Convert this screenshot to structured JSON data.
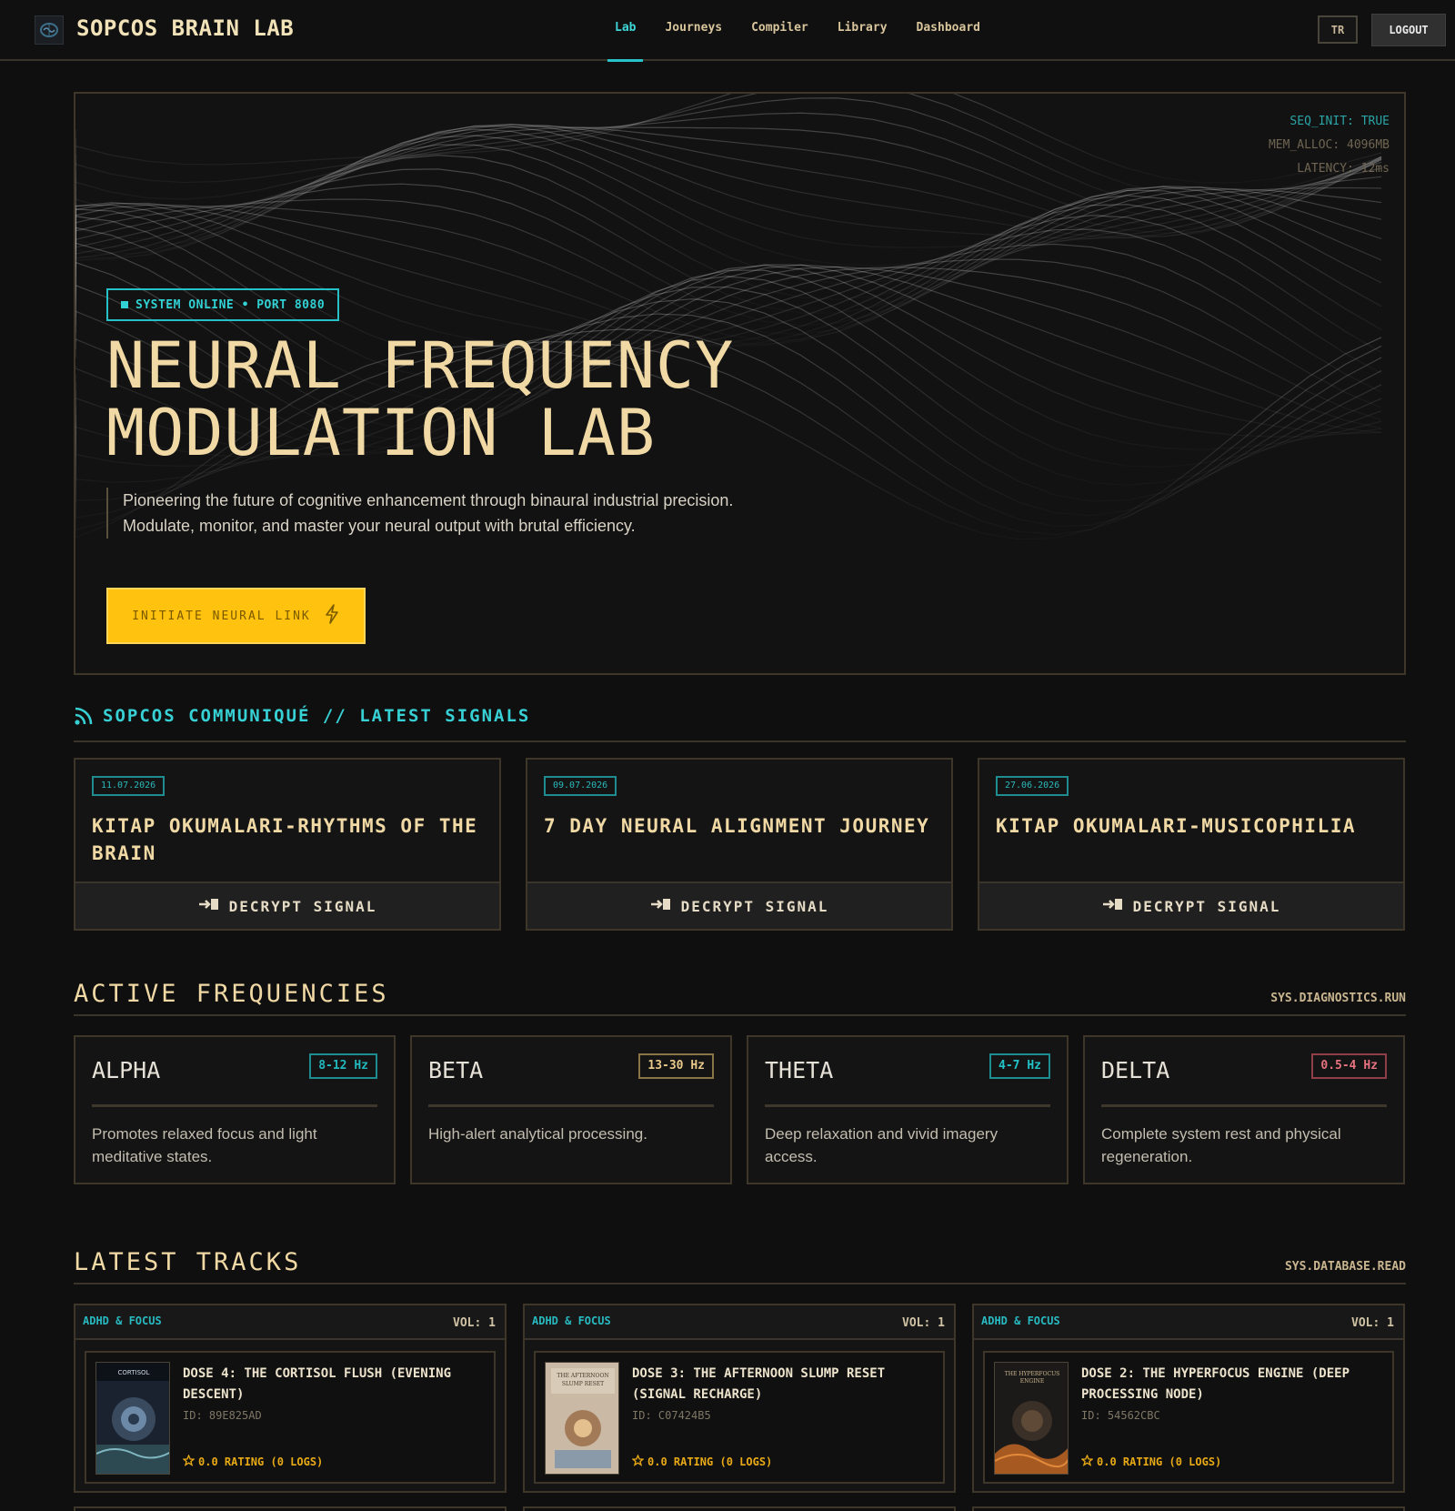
{
  "nav": {
    "brand": "SOPCOS BRAIN LAB",
    "links": [
      "Lab",
      "Journeys",
      "Compiler",
      "Library",
      "Dashboard"
    ],
    "active": "Lab",
    "lang_button": "TR",
    "logout_button": "LOGOUT"
  },
  "hero": {
    "stats": [
      "SEQ_INIT: TRUE",
      "MEM_ALLOC: 4096MB",
      "LATENCY: 12ms"
    ],
    "badge": "SYSTEM ONLINE • PORT 8080",
    "title_line1": "NEURAL FREQUENCY",
    "title_line2": "MODULATION LAB",
    "description": "Pioneering the future of cognitive enhancement through binaural industrial precision. Modulate, monitor, and master your neural output with brutal efficiency.",
    "cta": "INITIATE NEURAL LINK"
  },
  "communique": {
    "title": "SOPCOS COMMUNIQUÉ // LATEST SIGNALS",
    "icon": "rss-icon",
    "signals": [
      {
        "date": "11.07.2026",
        "title": "KITAP OKUMALARI-RHYTHMS OF THE BRAIN",
        "action": "DECRYPT SIGNAL"
      },
      {
        "date": "09.07.2026",
        "title": "7 DAY NEURAL ALIGNMENT JOURNEY",
        "action": "DECRYPT SIGNAL"
      },
      {
        "date": "27.06.2026",
        "title": "KITAP OKUMALARI-MUSICOPHILIA",
        "action": "DECRYPT SIGNAL"
      }
    ]
  },
  "frequencies": {
    "title": "ACTIVE FREQUENCIES",
    "meta": "SYS.DIAGNOSTICS.RUN",
    "items": [
      {
        "name": "ALPHA",
        "range": "8-12 Hz",
        "color": "#22b8bd",
        "description": "Promotes relaxed focus and light meditative states."
      },
      {
        "name": "BETA",
        "range": "13-30 Hz",
        "color": "#e9c98a",
        "description": "High-alert analytical processing."
      },
      {
        "name": "THETA",
        "range": "4-7 Hz",
        "color": "#22c3c8",
        "description": "Deep relaxation and vivid imagery access."
      },
      {
        "name": "DELTA",
        "range": "0.5-4 Hz",
        "color": "#e6737f",
        "description": "Complete system rest and physical regeneration."
      }
    ]
  },
  "tracks": {
    "title": "LATEST TRACKS",
    "meta": "SYS.DATABASE.READ",
    "items": [
      {
        "category": "ADHD & FOCUS",
        "vol": "VOL: 1",
        "title": "DOSE 4: THE CORTISOL FLUSH (EVENING DESCENT)",
        "id": "ID: 89E825AD",
        "rating": "0.0 RATING (0 LOGS)",
        "cover_caption": "CORTISOL"
      },
      {
        "category": "ADHD & FOCUS",
        "vol": "VOL: 1",
        "title": "DOSE 3: THE AFTERNOON SLUMP RESET (SIGNAL RECHARGE)",
        "id": "ID: C07424B5",
        "rating": "0.0 RATING (0 LOGS)",
        "cover_caption": "THE AFTERNOON SLUMP RESET"
      },
      {
        "category": "ADHD & FOCUS",
        "vol": "VOL: 1",
        "title": "DOSE 2: THE HYPERFOCUS ENGINE (DEEP PROCESSING NODE)",
        "id": "ID: 54562CBC",
        "rating": "0.0 RATING (0 LOGS)",
        "cover_caption": "THE HYPERFOCUS ENGINE"
      }
    ]
  }
}
